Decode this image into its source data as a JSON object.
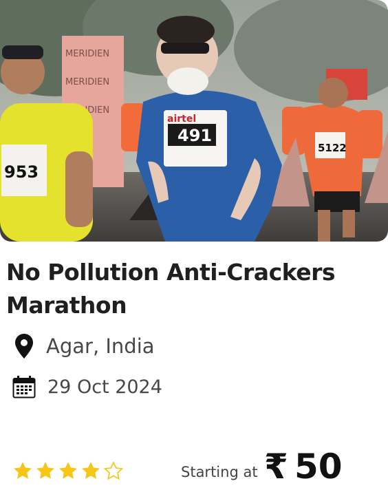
{
  "event": {
    "title": "No Pollution Anti-Crackers Marathon",
    "location": "Agar, India",
    "date": "29 Oct 2024",
    "rating": 4,
    "rating_max": 5,
    "price_label": "Starting at",
    "currency_symbol": "₹",
    "price": "50"
  },
  "photo": {
    "banner_text": "MERIDIEN",
    "bib_numbers": [
      "953",
      "491",
      "5122"
    ],
    "sponsor": "airtel"
  },
  "icons": {
    "location": "map-pin-icon",
    "date": "calendar-icon",
    "star_filled": "star-filled-icon",
    "star_empty": "star-outline-icon"
  },
  "colors": {
    "star": "#f5c518",
    "title": "#1f1f1f",
    "meta_text": "#474747"
  }
}
